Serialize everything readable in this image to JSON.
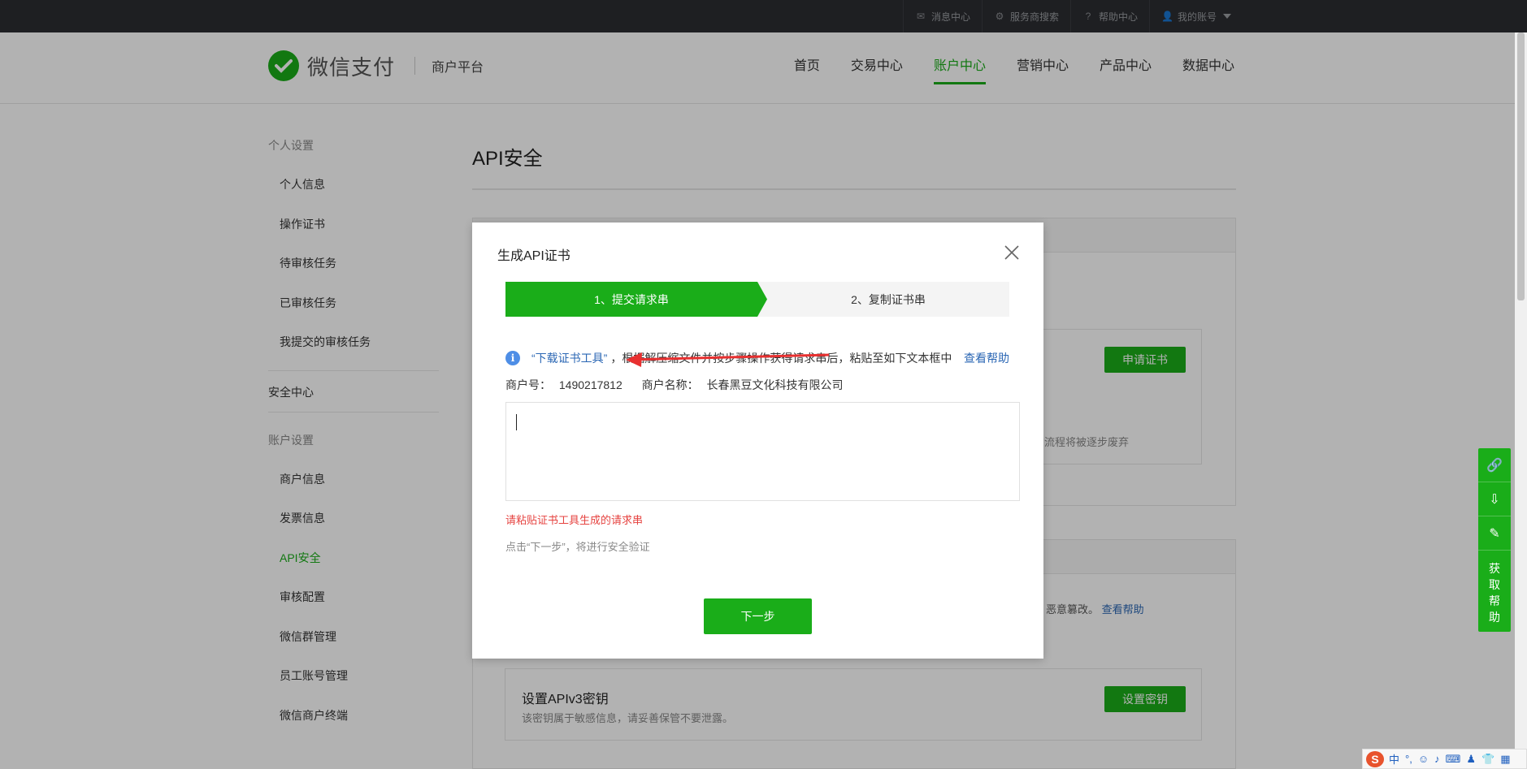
{
  "topbar": {
    "links": [
      {
        "label": "消息中心",
        "icon": "mail-icon"
      },
      {
        "label": "服务商搜索",
        "icon": "search-icon"
      },
      {
        "label": "帮助中心",
        "icon": "help-icon"
      },
      {
        "label": "我的账号",
        "icon": "user-icon"
      }
    ]
  },
  "header": {
    "brand": "微信支付",
    "sub": "商户平台",
    "nav": [
      "首页",
      "交易中心",
      "账户中心",
      "营销中心",
      "产品中心",
      "数据中心"
    ],
    "active_nav": "账户中心"
  },
  "sidebar": {
    "group1": "个人设置",
    "items1": [
      "个人信息",
      "操作证书",
      "待审核任务",
      "已审核任务",
      "我提交的审核任务"
    ],
    "section": "安全中心",
    "group2": "账户设置",
    "items2": [
      "商户信息",
      "发票信息",
      "API安全",
      "审核配置",
      "微信群管理",
      "员工账号管理",
      "微信商户终端"
    ],
    "active_item": "API安全"
  },
  "main": {
    "title": "API安全",
    "apply_cert_button": "申请证书",
    "partial_desc": "的流程将被逐步废弃",
    "partial_desc2": "恶意篡改。",
    "help_link": "查看帮助",
    "v3_title": "设置APIv3密钥",
    "v3_desc": "该密钥属于敏感信息，请妥善保管不要泄露。",
    "v3_button": "设置密钥"
  },
  "modal": {
    "title": "生成API证书",
    "step1": "1、提交请求串",
    "step2": "2、复制证书串",
    "info_link": "“下载证书工具”",
    "info_text": "，根据解压缩文件并按步骤操作获得请求串后，粘贴至如下文本框中",
    "info_help": "查看帮助",
    "merchant_id_label": "商户号：",
    "merchant_id": "1490217812",
    "merchant_name_label": "商户名称：",
    "merchant_name": "长春黑豆文化科技有限公司",
    "error": "请粘贴证书工具生成的请求串",
    "hint": "点击“下一步”，将进行安全验证",
    "next_button": "下一步"
  },
  "float_bar": {
    "icons": [
      "link-icon",
      "download-icon",
      "edit-icon"
    ],
    "help_text": "获取帮助"
  },
  "ime": {
    "logo": "S",
    "items": [
      "中",
      "°,",
      "☺",
      "♪",
      "⌨",
      "♟",
      "👕",
      "▦"
    ]
  },
  "colors": {
    "brand_green": "#1aad19",
    "error_red": "#e64340",
    "link_blue": "#2b67b4",
    "topbar_bg": "#2b2d31"
  }
}
